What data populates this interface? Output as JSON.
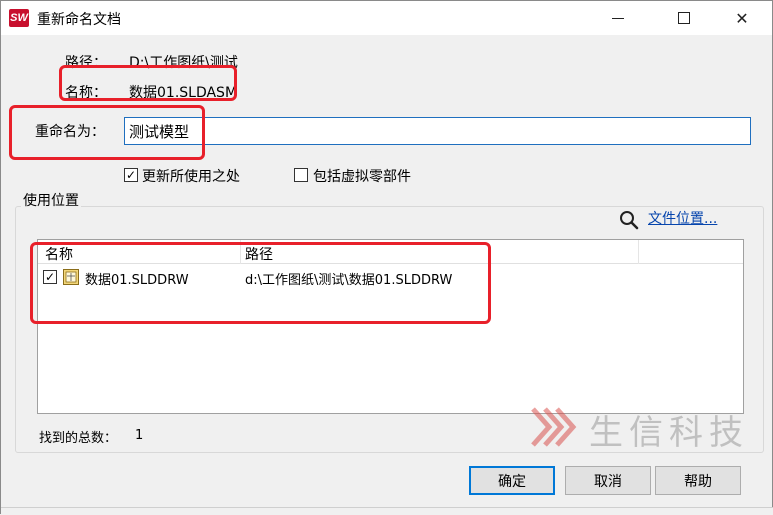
{
  "window": {
    "title": "重新命名文档",
    "app_icon_text": "SW"
  },
  "form": {
    "path_label": "路径：",
    "path_value": "D:\\工作图纸\\测试",
    "name_label": "名称：",
    "name_value": "数据01.SLDASM",
    "rename_label": "重命名为：",
    "rename_value": "测试模型",
    "update_usages_label": "更新所使用之处",
    "update_usages_checked": true,
    "include_virtual_label": "包括虚拟零部件",
    "include_virtual_checked": false
  },
  "usage": {
    "group_label": "使用位置",
    "file_location_link": "文件位置...",
    "columns": [
      "名称",
      "路径"
    ],
    "rows": [
      {
        "checked": true,
        "name": "数据01.SLDDRW",
        "path": "d:\\工作图纸\\测试\\数据01.SLDDRW"
      }
    ],
    "found_label": "找到的总数：",
    "found_count": "1"
  },
  "buttons": {
    "ok": "确定",
    "cancel": "取消",
    "help": "帮助"
  },
  "watermark": {
    "text": "生信科技"
  },
  "colors": {
    "highlight_box": "#e8202a",
    "link": "#0645ad",
    "focus": "#0078d7"
  }
}
